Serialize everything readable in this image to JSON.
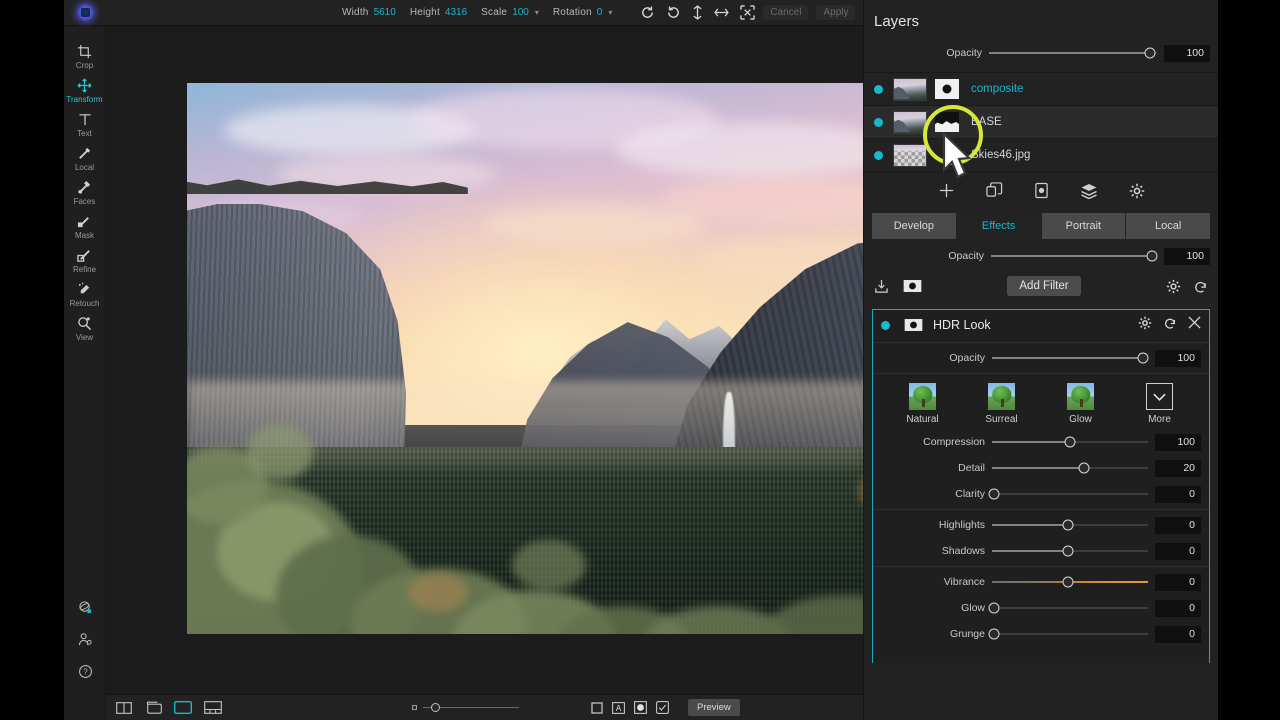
{
  "app": {
    "logo_icon": "app-logo-icon"
  },
  "topbar": {
    "width_label": "Width",
    "width_value": "5610",
    "height_label": "Height",
    "height_value": "4316",
    "scale_label": "Scale",
    "scale_value": "100",
    "rotation_label": "Rotation",
    "rotation_value": "0",
    "cancel_label": "Cancel",
    "apply_label": "Apply",
    "icons": [
      "rotate-ccw-icon",
      "rotate-cw-icon",
      "flip-vertical-icon",
      "flip-horizontal-icon",
      "fit-to-screen-icon"
    ]
  },
  "toolrail": {
    "tools": [
      {
        "label": "Crop",
        "icon": "crop-icon",
        "active": false
      },
      {
        "label": "Transform",
        "icon": "transform-icon",
        "active": true
      },
      {
        "label": "Text",
        "icon": "text-icon",
        "active": false
      },
      {
        "label": "Local",
        "icon": "local-brush-icon",
        "active": false
      },
      {
        "label": "Faces",
        "icon": "faces-icon",
        "active": false
      },
      {
        "label": "Mask",
        "icon": "mask-brush-icon",
        "active": false
      },
      {
        "label": "Refine",
        "icon": "refine-icon",
        "active": false
      },
      {
        "label": "Retouch",
        "icon": "retouch-icon",
        "active": false
      },
      {
        "label": "View",
        "icon": "view-zoom-icon",
        "active": false
      }
    ],
    "bottom_icons": [
      "3d-orbit-icon",
      "person-icon",
      "help-icon"
    ]
  },
  "canvas": {
    "image_description": "Yosemite Valley tunnel view at sunset with El Capitan, Half Dome, Bridalveil Fall and blurred foreground foliage"
  },
  "bottombar": {
    "zoom_small_icon": "zoom-small-icon",
    "zoom_knob_icon": "zoom-knob-icon",
    "icons": [
      "compare-square-icon",
      "before-after-a-icon",
      "soft-proof-icon",
      "checkmark-box-icon"
    ],
    "preview_label": "Preview",
    "view_icons": [
      "split-view-icon",
      "single-view-icon",
      "browser-view-icon",
      "filmstrip-view-icon"
    ]
  },
  "layers_panel": {
    "title": "Layers",
    "opacity_label": "Opacity",
    "opacity_value": "100",
    "layers": [
      {
        "name": "composite",
        "visible": true,
        "thumb": "photo",
        "mask": "dot",
        "selected": false,
        "highlighted_name": true
      },
      {
        "name": "BASE",
        "visible": true,
        "thumb": "photo",
        "mask": "shape",
        "selected": true,
        "highlighted_name": false
      },
      {
        "name": "Skies46.jpg",
        "visible": true,
        "thumb": "checker",
        "mask": "none",
        "selected": false,
        "highlighted_name": false
      }
    ],
    "tool_icons": [
      "add-layer-icon",
      "duplicate-layer-icon",
      "layer-mask-icon",
      "merge-layers-icon",
      "layer-settings-icon"
    ]
  },
  "tabs": [
    {
      "label": "Develop",
      "active": false
    },
    {
      "label": "Effects",
      "active": true
    },
    {
      "label": "Portrait",
      "active": false
    },
    {
      "label": "Local",
      "active": false
    }
  ],
  "effects": {
    "opacity_label": "Opacity",
    "opacity_value": "100",
    "import_icon": "import-preset-icon",
    "mask_icon": "filter-mask-icon",
    "add_filter_label": "Add Filter",
    "settings_icon": "gear-icon",
    "reset_icon": "reset-icon"
  },
  "filter": {
    "name": "HDR Look",
    "enabled": true,
    "mask_icon": "filter-mask-icon",
    "settings_icon": "gear-icon",
    "reset_icon": "reset-icon",
    "close_icon": "close-icon",
    "opacity_label": "Opacity",
    "opacity_value": "100",
    "presets": [
      {
        "label": "Natural",
        "icon": "tree-preset-icon"
      },
      {
        "label": "Surreal",
        "icon": "tree-preset-icon"
      },
      {
        "label": "Glow",
        "icon": "tree-preset-icon"
      },
      {
        "label": "More",
        "icon": "chevron-down-icon"
      }
    ],
    "sliders": [
      {
        "label": "Compression",
        "value": "100",
        "knob_pct": 50,
        "fill_pct": 50,
        "style": "plain",
        "group": 1
      },
      {
        "label": "Detail",
        "value": "20",
        "knob_pct": 59,
        "fill_pct": 59,
        "style": "plain",
        "group": 1
      },
      {
        "label": "Clarity",
        "value": "0",
        "knob_pct": 1,
        "fill_pct": 0,
        "style": "plain",
        "group": 1
      },
      {
        "label": "Highlights",
        "value": "0",
        "knob_pct": 49,
        "fill_pct": 49,
        "style": "plain",
        "group": 2
      },
      {
        "label": "Shadows",
        "value": "0",
        "knob_pct": 49,
        "fill_pct": 49,
        "style": "plain",
        "group": 2
      },
      {
        "label": "Vibrance",
        "value": "0",
        "knob_pct": 49,
        "fill_pct": 0,
        "style": "orange",
        "group": 3
      },
      {
        "label": "Glow",
        "value": "0",
        "knob_pct": 1,
        "fill_pct": 0,
        "style": "plain",
        "group": 3
      },
      {
        "label": "Grunge",
        "value": "0",
        "knob_pct": 1,
        "fill_pct": 0,
        "style": "plain",
        "group": 3
      }
    ]
  },
  "colors": {
    "accent_teal": "#18b8cf",
    "panel_bg": "#222222",
    "filter_border": "#1fa8c4",
    "highlight_ring": "#d8e83a",
    "vibrance_track": "#e09a45"
  },
  "annotation": {
    "highlight_ring_icon": "highlight-circle-annotation",
    "cursor_icon": "mouse-cursor-icon"
  }
}
